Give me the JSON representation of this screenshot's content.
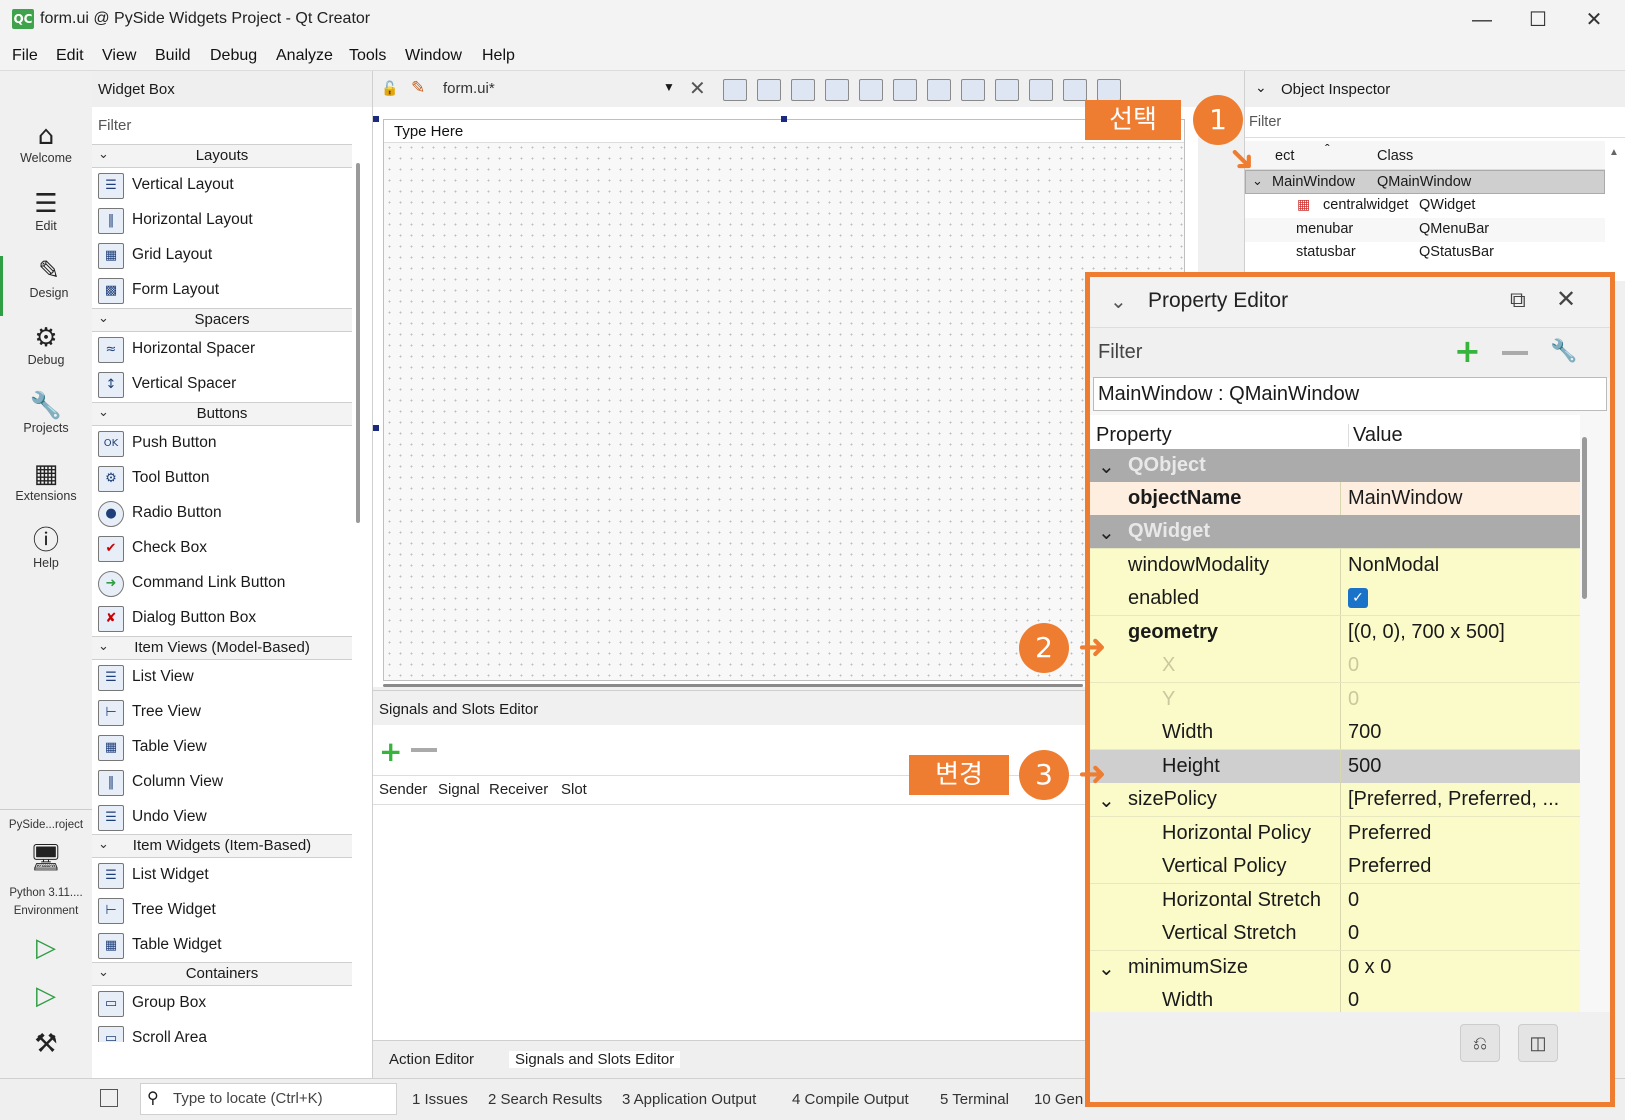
{
  "title_bar": {
    "logo": "QC",
    "title": "form.ui @ PySide Widgets Project - Qt Creator"
  },
  "menu": [
    "File",
    "Edit",
    "View",
    "Build",
    "Debug",
    "Analyze",
    "Tools",
    "Window",
    "Help"
  ],
  "modes": [
    {
      "label": "Welcome",
      "icon": "home-icon"
    },
    {
      "label": "Edit",
      "icon": "edit-lines-icon"
    },
    {
      "label": "Design",
      "icon": "pen-icon"
    },
    {
      "label": "Debug",
      "icon": "bug-icon"
    },
    {
      "label": "Projects",
      "icon": "wrench-icon"
    },
    {
      "label": "Extensions",
      "icon": "extensions-icon"
    },
    {
      "label": "Help",
      "icon": "help-icon"
    }
  ],
  "kit": {
    "project": "PySide...roject",
    "env1": "Python 3.11....",
    "env2": "Environment"
  },
  "widget_box": {
    "title": "Widget Box",
    "filter": "Filter",
    "categories": {
      "layouts": "Layouts",
      "spacers": "Spacers",
      "buttons": "Buttons",
      "item_views": "Item Views (Model-Based)",
      "item_widgets": "Item Widgets (Item-Based)",
      "containers": "Containers"
    },
    "items": {
      "vertical_layout": "Vertical Layout",
      "horizontal_layout": "Horizontal Layout",
      "grid_layout": "Grid Layout",
      "form_layout": "Form Layout",
      "horizontal_spacer": "Horizontal Spacer",
      "vertical_spacer": "Vertical Spacer",
      "push_button": "Push Button",
      "tool_button": "Tool Button",
      "radio_button": "Radio Button",
      "check_box": "Check Box",
      "command_link_button": "Command Link Button",
      "dialog_button_box": "Dialog Button Box",
      "list_view": "List View",
      "tree_view": "Tree View",
      "table_view": "Table View",
      "column_view": "Column View",
      "undo_view": "Undo View",
      "list_widget": "List Widget",
      "tree_widget": "Tree Widget",
      "table_widget": "Table Widget",
      "group_box": "Group Box",
      "scroll_area": "Scroll Area"
    }
  },
  "form_toolbar": {
    "file": "form.ui*"
  },
  "canvas": {
    "menu_placeholder": "Type Here"
  },
  "signals_slots": {
    "title": "Signals and Slots Editor",
    "columns": [
      "Sender",
      "Signal",
      "Receiver",
      "Slot"
    ]
  },
  "bottom_tabs": [
    "Action Editor",
    "Signals and Slots Editor"
  ],
  "status_bar": {
    "locate_placeholder": "Type to locate (Ctrl+K)",
    "outputs": [
      "1  Issues",
      "2  Search Results",
      "3  Application Output",
      "4  Compile Output",
      "5  Terminal",
      "10  Gen"
    ]
  },
  "object_inspector": {
    "title": "Object Inspector",
    "filter": "Filter",
    "col_object": "ect",
    "col_class": "Class",
    "rows": [
      {
        "object": "MainWindow",
        "class": "QMainWindow"
      },
      {
        "object": "centralwidget",
        "class": "QWidget"
      },
      {
        "object": "menubar",
        "class": "QMenuBar"
      },
      {
        "object": "statusbar",
        "class": "QStatusBar"
      }
    ]
  },
  "property_editor": {
    "title": "Property Editor",
    "filter": "Filter",
    "object_label": "MainWindow : QMainWindow",
    "col_property": "Property",
    "col_value": "Value",
    "sections": {
      "qobject": "QObject",
      "qwidget": "QWidget"
    },
    "rows": {
      "objectName": {
        "name": "objectName",
        "value": "MainWindow"
      },
      "windowModality": {
        "name": "windowModality",
        "value": "NonModal"
      },
      "enabled": {
        "name": "enabled",
        "value": true
      },
      "geometry": {
        "name": "geometry",
        "value": "[(0, 0), 700 x 500]"
      },
      "x": {
        "name": "X",
        "value": "0"
      },
      "y": {
        "name": "Y",
        "value": "0"
      },
      "width": {
        "name": "Width",
        "value": "700"
      },
      "height": {
        "name": "Height",
        "value": "500"
      },
      "sizePolicy": {
        "name": "sizePolicy",
        "value": "[Preferred, Preferred, ..."
      },
      "hpolicy": {
        "name": "Horizontal Policy",
        "value": "Preferred"
      },
      "vpolicy": {
        "name": "Vertical Policy",
        "value": "Preferred"
      },
      "hstretch": {
        "name": "Horizontal Stretch",
        "value": "0"
      },
      "vstretch": {
        "name": "Vertical Stretch",
        "value": "0"
      },
      "minimumSize": {
        "name": "minimumSize",
        "value": "0 x 0"
      },
      "minWidth": {
        "name": "Width",
        "value": "0"
      }
    }
  },
  "annotations": {
    "select_label": "선택",
    "change_label": "변경",
    "step1": "1",
    "step2": "2",
    "step3": "3"
  },
  "colors": {
    "accent": "#ee7d31",
    "property_yellow": "#fbfbc9",
    "section_gray": "#ababab",
    "selection": "#cfd9ea"
  }
}
